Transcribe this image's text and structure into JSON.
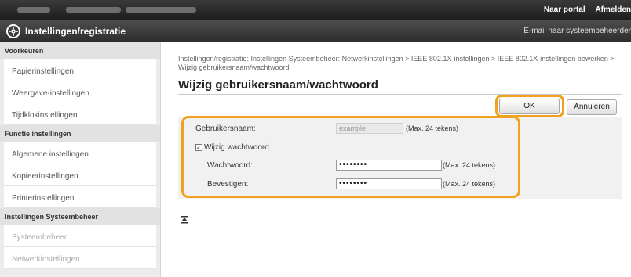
{
  "topbar": {
    "links": [
      "Naar portal",
      "Afmelden"
    ]
  },
  "titlebar": {
    "title": "Instellingen/registratie",
    "logo_icon": "gear-icon",
    "mail_link": "E-mail naar systeembeheerder"
  },
  "sidebar": {
    "sections": [
      {
        "heading": "Voorkeuren",
        "items": [
          "Papierinstellingen",
          "Weergave-instellingen",
          "Tijdklokinstellingen"
        ]
      },
      {
        "heading": "Functie instellingen",
        "items": [
          "Algemene instellingen",
          "Kopieerinstellingen",
          "Printerinstellingen"
        ]
      },
      {
        "heading": "Instellingen Systeembeheer",
        "items": [
          "Systeembeheer",
          "Netwerkinstellingen"
        ]
      }
    ]
  },
  "main": {
    "breadcrumb": "Instellingen/registratie: Instellingen Systeembeheer: Netwerkinstellingen > IEEE 802.1X-instellingen > IEEE 802.1X-instellingen bewerken > Wijzig gebruikersnaam/wachtwoord",
    "title": "Wijzig gebruikersnaam/wachtwoord",
    "ok_label": "OK",
    "cancel_label": "Annuleren",
    "form": {
      "username_label": "Gebruikersnaam:",
      "username_value": "example",
      "username_note": "(Max. 24 tekens)",
      "change_password_label": "Wijzig wachtwoord",
      "change_password_checked": "✓",
      "password_label": "Wachtwoord:",
      "password_value": "••••••••",
      "password_note": "(Max. 24 tekens)",
      "confirm_label": "Bevestigen:",
      "confirm_value": "••••••••",
      "confirm_note": "(Max. 24 tekens)"
    },
    "to_top_icon": "arrow-up-to-top-icon"
  },
  "colors": {
    "highlight": "#f0a21e",
    "bar": "#2d2d2d"
  }
}
